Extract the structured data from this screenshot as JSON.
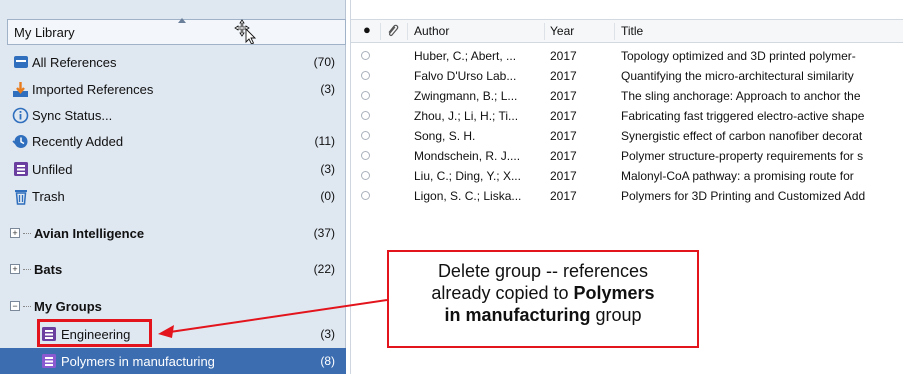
{
  "sidebar": {
    "library_title": "My Library",
    "items": [
      {
        "label": "All References",
        "count": "(70)",
        "icon": "all-references-icon"
      },
      {
        "label": "Imported References",
        "count": "(3)",
        "icon": "import-icon"
      },
      {
        "label": "Sync Status...",
        "count": "",
        "icon": "info-icon"
      },
      {
        "label": "Recently Added",
        "count": "(11)",
        "icon": "recent-icon"
      },
      {
        "label": "Unfiled",
        "count": "(3)",
        "icon": "unfiled-icon"
      },
      {
        "label": "Trash",
        "count": "(0)",
        "icon": "trash-icon"
      }
    ],
    "groups": [
      {
        "label": "Avian Intelligence",
        "count": "(37)",
        "toggle": "+"
      },
      {
        "label": "Bats",
        "count": "(22)",
        "toggle": "+"
      },
      {
        "label": "My Groups",
        "count": "",
        "toggle": "−"
      }
    ],
    "sub_groups": [
      {
        "label": "Engineering",
        "count": "(3)"
      },
      {
        "label": "Polymers in manufacturing",
        "count": "(8)"
      }
    ]
  },
  "table": {
    "columns": {
      "read": "●",
      "attachment": "paperclip-icon",
      "author": "Author",
      "year": "Year",
      "title": "Title"
    },
    "rows": [
      {
        "author": "Huber, C.; Abert, ...",
        "year": "2017",
        "title": "Topology optimized and 3D printed polymer-"
      },
      {
        "author": "Falvo D'Urso Lab...",
        "year": "2017",
        "title": "Quantifying the micro-architectural similarity"
      },
      {
        "author": "Zwingmann, B.; L...",
        "year": "2017",
        "title": "The sling anchorage: Approach to anchor the"
      },
      {
        "author": "Zhou, J.; Li, H.; Ti...",
        "year": "2017",
        "title": "Fabricating fast triggered electro-active shape"
      },
      {
        "author": "Song, S. H.",
        "year": "2017",
        "title": "Synergistic effect of carbon nanofiber decorat"
      },
      {
        "author": "Mondschein, R. J....",
        "year": "2017",
        "title": "Polymer structure-property requirements for s"
      },
      {
        "author": "Liu, C.; Ding, Y.; X...",
        "year": "2017",
        "title": "Malonyl-CoA pathway: a promising route for"
      },
      {
        "author": "Ligon, S. C.; Liska...",
        "year": "2017",
        "title": "Polymers for 3D Printing and Customized Add"
      }
    ]
  },
  "callout": {
    "line1": "Delete group -- references",
    "line2_pre": "already copied to ",
    "line2_bold": "Polymers",
    "line3_bold": "in manufacturing",
    "line3_post": " group"
  },
  "colors": {
    "annotation": "#e3141c",
    "selection": "#3c6db0",
    "icon_blue": "#2f6fbd",
    "icon_purple": "#6b3fa0"
  }
}
